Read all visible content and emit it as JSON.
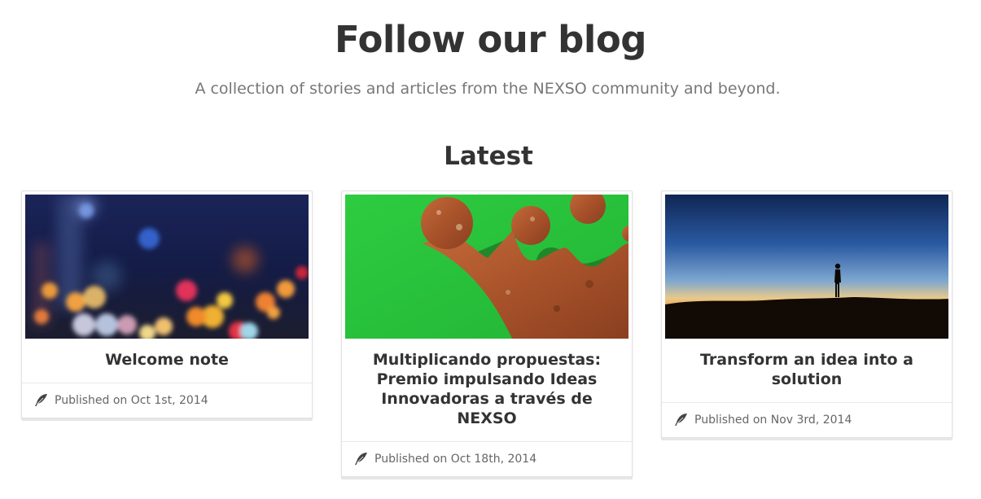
{
  "header": {
    "title": "Follow our blog",
    "subtitle": "A collection of stories and articles from the NEXSO community and beyond."
  },
  "latest": {
    "section_title": "Latest",
    "posts": [
      {
        "title": "Welcome note",
        "published": "Published on Oct 1st, 2014",
        "icon": "feather-icon"
      },
      {
        "title": "Multiplicando propuestas: Premio impulsando Ideas Innovadoras a través de NEXSO",
        "published": "Published on Oct 18th, 2014",
        "icon": "feather-icon"
      },
      {
        "title": "Transform an idea into a solution",
        "published": "Published on Nov 3rd, 2014",
        "icon": "feather-icon"
      }
    ]
  },
  "colors": {
    "heading": "#333333",
    "subtitle": "#777777",
    "card_border": "#e2e2e2",
    "footer_text": "#666666"
  }
}
